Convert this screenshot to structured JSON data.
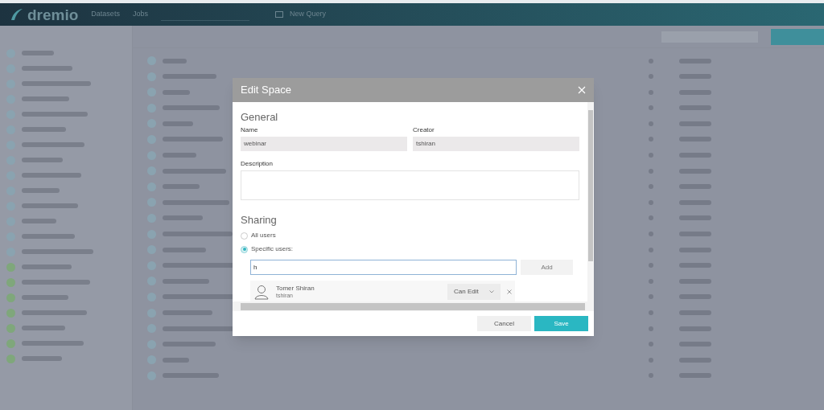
{
  "app_header": {
    "logo": "dremio",
    "nav": [
      "Datasets",
      "Jobs"
    ],
    "new_query": "New Query"
  },
  "dialog": {
    "title": "Edit Space",
    "general": {
      "heading": "General",
      "name_label": "Name",
      "name_value": "webinar",
      "creator_label": "Creator",
      "creator_value": "tshiran",
      "description_label": "Description"
    },
    "sharing": {
      "heading": "Sharing",
      "options": [
        {
          "label": "All users",
          "selected": false
        },
        {
          "label": "Specific users:",
          "selected": true
        }
      ],
      "user_input_value": "h",
      "add_button": "Add",
      "users": [
        {
          "name": "Tomer Shiran",
          "username": "tshiran",
          "permission": "Can Edit"
        }
      ]
    },
    "buttons": [
      {
        "label": "Cancel",
        "kind": "secondary"
      },
      {
        "label": "Save",
        "kind": "primary"
      }
    ]
  }
}
